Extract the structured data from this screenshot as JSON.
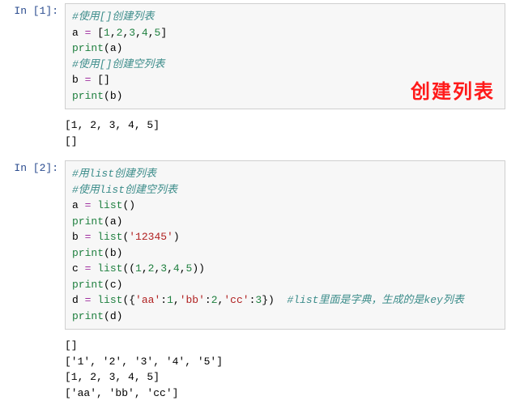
{
  "cell1": {
    "prompt": "In  [1]:",
    "lines": {
      "l0_comment": "#使用[]创建列表",
      "l1_var": "a",
      "l1_op": " = ",
      "l1_br_open": "[",
      "l1_n1": "1",
      "l1_c1": ",",
      "l1_n2": "2",
      "l1_c2": ",",
      "l1_n3": "3",
      "l1_c3": ",",
      "l1_n4": "4",
      "l1_c4": ",",
      "l1_n5": "5",
      "l1_br_close": "]",
      "l2_fn": "print",
      "l2_arg": "(a)",
      "l3_comment": "#使用[]创建空列表",
      "l4_var": "b",
      "l4_op": " = ",
      "l4_val": "[]",
      "l5_fn": "print",
      "l5_arg": "(b)"
    },
    "annotation": "创建列表",
    "output": "[1, 2, 3, 4, 5]\n[]"
  },
  "cell2": {
    "prompt": "In  [2]:",
    "lines": {
      "l0_comment": "#用list创建列表",
      "l1_comment": "#使用list创建空列表",
      "l2_var": "a",
      "l2_op": " = ",
      "l2_fn": "list",
      "l2_par": "()",
      "l3_fn": "print",
      "l3_arg": "(a)",
      "l4_var": "b",
      "l4_op": " = ",
      "l4_fn": "list",
      "l4_po": "(",
      "l4_str": "'12345'",
      "l4_pc": ")",
      "l5_fn": "print",
      "l5_arg": "(b)",
      "l6_var": "c",
      "l6_op": " = ",
      "l6_fn": "list",
      "l6_po": "((",
      "l6_n1": "1",
      "l6_c1": ",",
      "l6_n2": "2",
      "l6_c2": ",",
      "l6_n3": "3",
      "l6_c3": ",",
      "l6_n4": "4",
      "l6_c4": ",",
      "l6_n5": "5",
      "l6_pc": "))",
      "l7_fn": "print",
      "l7_arg": "(c)",
      "l8_var": "d",
      "l8_op": " = ",
      "l8_fn": "list",
      "l8_po": "({",
      "l8_s1": "'aa'",
      "l8_col1": ":",
      "l8_v1": "1",
      "l8_cm1": ",",
      "l8_s2": "'bb'",
      "l8_col2": ":",
      "l8_v2": "2",
      "l8_cm2": ",",
      "l8_s3": "'cc'",
      "l8_col3": ":",
      "l8_v3": "3",
      "l8_pc": "})",
      "l8_sp": "  ",
      "l8_comment": "#list里面是字典，生成的是key列表",
      "l9_fn": "print",
      "l9_arg": "(d)"
    },
    "output": "[]\n['1', '2', '3', '4', '5']\n[1, 2, 3, 4, 5]\n['aa', 'bb', 'cc']"
  }
}
